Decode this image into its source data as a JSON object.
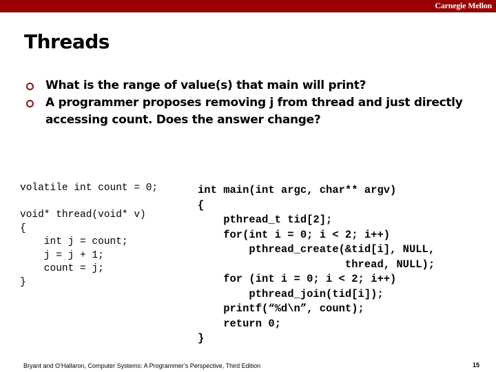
{
  "header": {
    "brand": "Carnegie Mellon",
    "brand_color": "#990000"
  },
  "slide": {
    "title": "Threads",
    "bullets": [
      {
        "icon": "circle-bullet-icon",
        "text": "What is the range of value(s) that main will print?"
      },
      {
        "icon": "circle-bullet-icon",
        "text": "A programmer proposes removing j from thread and just directly accessing count.  Does the answer change?"
      }
    ]
  },
  "code_left": {
    "lines": [
      "volatile int count = 0;",
      "",
      "void* thread(void* v)",
      "{",
      "    int j = count;",
      "    j = j + 1;",
      "    count = j;",
      "}"
    ]
  },
  "code_right": {
    "lines": [
      "int main(int argc, char** argv)",
      "{",
      "    pthread_t tid[2];",
      "    for(int i = 0; i < 2; i++)",
      "        pthread_create(&tid[i], NULL,",
      "                       thread, NULL);",
      "    for (int i = 0; i < 2; i++)",
      "        pthread_join(tid[i]);",
      "    printf(“%d\\n”, count);",
      "    return 0;",
      "}"
    ]
  },
  "footer": {
    "credit": "Bryant and O’Hallaron, Computer Systems: A Programmer’s Perspective, Third Edition",
    "page_number": "15"
  }
}
